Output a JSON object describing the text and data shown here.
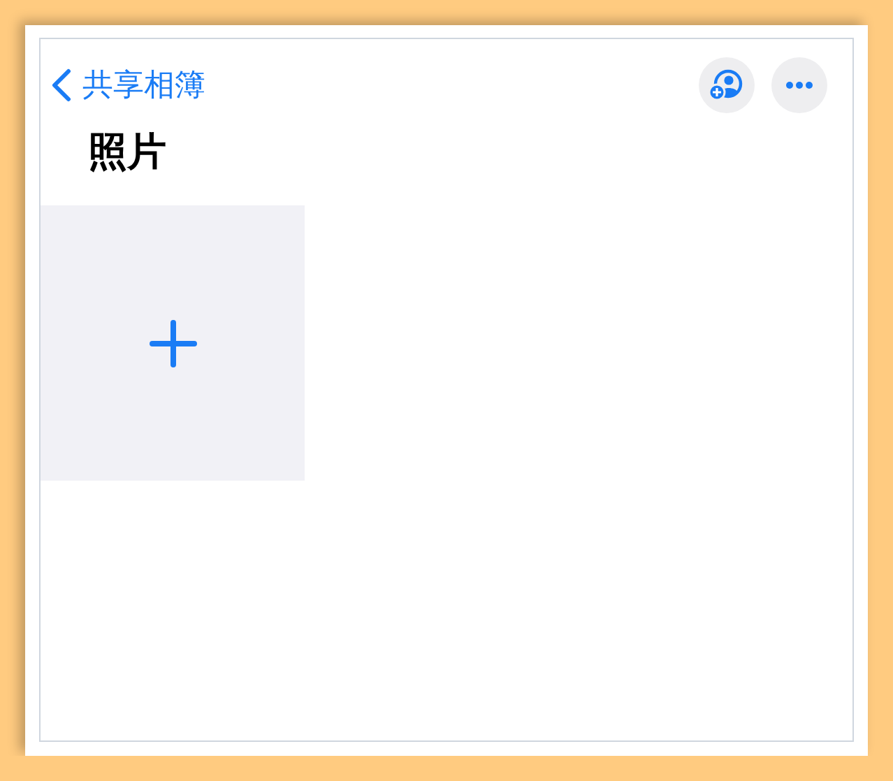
{
  "nav": {
    "back_label": "共享相簿"
  },
  "title": "照片",
  "tiles": [
    {
      "kind": "add"
    }
  ]
}
